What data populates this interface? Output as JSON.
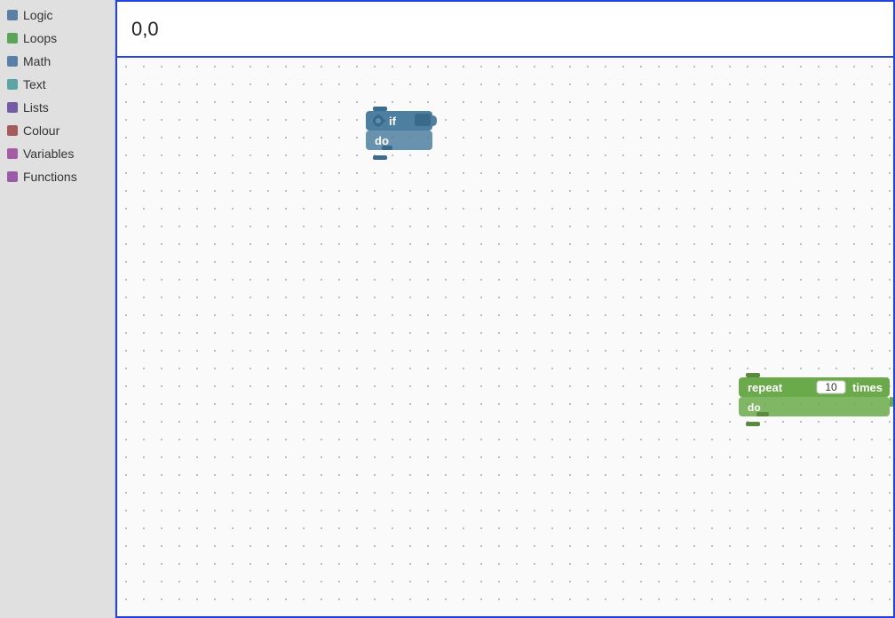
{
  "sidebar": {
    "items": [
      {
        "label": "Logic",
        "color": "#5b80a5",
        "id": "logic"
      },
      {
        "label": "Loops",
        "color": "#5ba55b",
        "id": "loops"
      },
      {
        "label": "Math",
        "color": "#5b80a5",
        "id": "math"
      },
      {
        "label": "Text",
        "color": "#5ba5a5",
        "id": "text"
      },
      {
        "label": "Lists",
        "color": "#745ba5",
        "id": "lists"
      },
      {
        "label": "Colour",
        "color": "#a55b5b",
        "id": "colour"
      },
      {
        "label": "Variables",
        "color": "#a55ba5",
        "id": "variables"
      },
      {
        "label": "Functions",
        "color": "#9a5ca6",
        "id": "functions"
      }
    ]
  },
  "coord": "0,0",
  "blocks": {
    "if_block": {
      "if_label": "if",
      "do_label": "do"
    },
    "repeat_block": {
      "repeat_label": "repeat",
      "times_label": "times",
      "do_label": "do",
      "value": "10"
    }
  },
  "sidebar_colors": {
    "logic": "#5b80a5",
    "loops": "#5ba55b",
    "math": "#5b80a5",
    "text": "#5ba5a5",
    "lists": "#745ba5",
    "colour": "#a55b5b",
    "variables": "#a55ba5",
    "functions": "#9a5ca6"
  }
}
